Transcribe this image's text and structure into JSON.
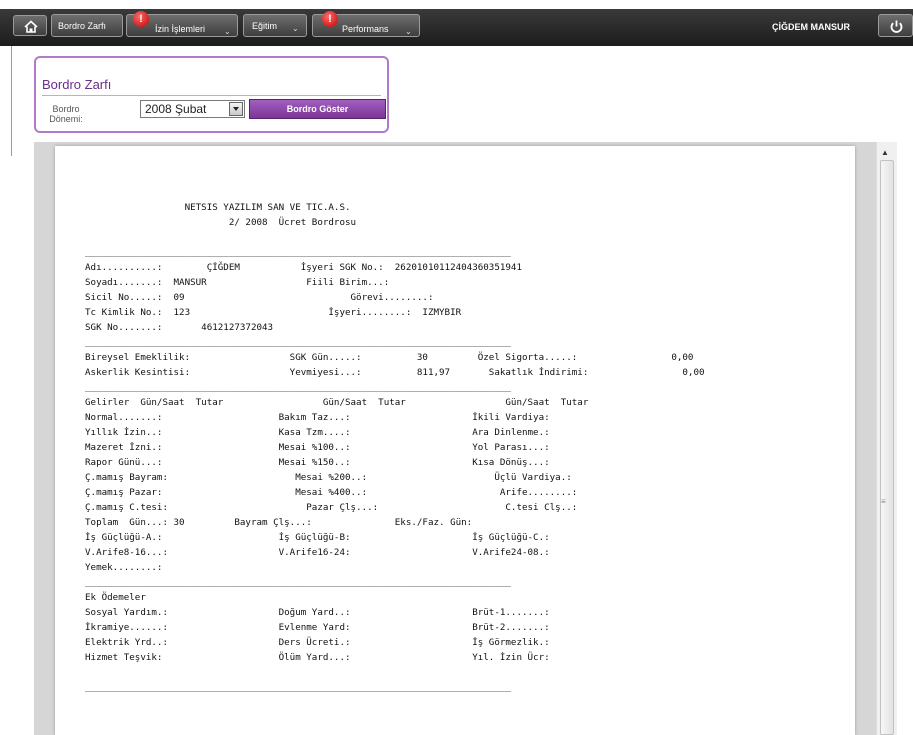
{
  "topbar": {
    "menu": [
      {
        "label": "Bordro Zarfı",
        "has_dropdown": false,
        "has_alert": false
      },
      {
        "label": "İzin İşlemleri",
        "has_dropdown": true,
        "has_alert": true
      },
      {
        "label": "Eğitim",
        "has_dropdown": true,
        "has_alert": false
      },
      {
        "label": "Performans",
        "has_dropdown": true,
        "has_alert": true
      }
    ],
    "alert_glyph": "!",
    "user_name": "ÇİĞDEM MANSUR",
    "home_icon": "home-icon",
    "logout_icon": "power-icon"
  },
  "panel": {
    "title": "Bordro Zarfı",
    "period_label": "Bordro Dönemi:",
    "period_value": "2008 Şubat",
    "show_button": "Bordro Göster"
  },
  "document": {
    "lines": [
      "                  NETSIS YAZILIM SAN VE TIC.A.S.",
      "                          2/ 2008  Ücret Bordrosu",
      "",
      "_____________________________________________________________________________",
      "Adı..........:        ÇİĞDEM           İşyeri SGK No.:  262010101124043603519​41",
      "Soyadı.......:  MANSUR                  Fiili Birim...:",
      "Sicil No.....:  09                              Görevi........:",
      "Tc Kimlik No.:  123                         İşyeri........:  IZMYBIR",
      "SGK No.......:       4612127372043",
      "_____________________________________________________________________________",
      "Bireysel Emeklilik:                  SGK Gün.....:          30         Özel Sigorta.....:                 0,00",
      "Askerlik Kesintisi:                  Yevmiyesi...:          811,97       Sakatlık İndirimi:                 0,00",
      "_____________________________________________________________________________",
      "Gelirler  Gün/Saat  Tutar                  Gün/Saat  Tutar                  Gün/Saat  Tutar",
      "Normal.......:                     Bakım Taz...:                      İkili Vardiya:",
      "Yıllık İzin..:                     Kasa Tzm....:                      Ara Dinlenme.:",
      "Mazeret İzni.:                     Mesai %100..:                      Yol Parası...:",
      "Rapor Günü...:                     Mesai %150..:                      Kısa Dönüş...:",
      "Ç.mamış Bayram:                       Mesai %200..:                       Üçlü Vardiya.:",
      "Ç.mamış Pazar:                        Mesai %400..:                        Arife........:",
      "Ç.mamış C.tesi:                         Pazar Çlş...:                       C.tesi Clş..:",
      "Toplam  Gün...: 30         Bayram Çlş...:               Eks./Faz. Gün:",
      "İş Güçlüğü-A.:                     İş Güçlüğü-B:                      İş Güçlüğü-C.:",
      "V.Arife8-16...:                    V.Arife16-24:                      V.Arife24-08.:",
      "Yemek........:",
      "_____________________________________________________________________________",
      "Ek Ödemeler",
      "Sosyal Yardım.:                    Doğum Yard..:                      Brüt-1.......:",
      "İkramiye......:                    Evlenme Yard:                      Brüt-2.......:",
      "Elektrik Yrd..:                    Ders Ücreti.:                      İş Görmezlik.:",
      "Hizmet Teşvik:                     Ölüm Yard...:                      Yıl. İzin Ücr:",
      "",
      "_____________________________________________________________________________"
    ]
  }
}
